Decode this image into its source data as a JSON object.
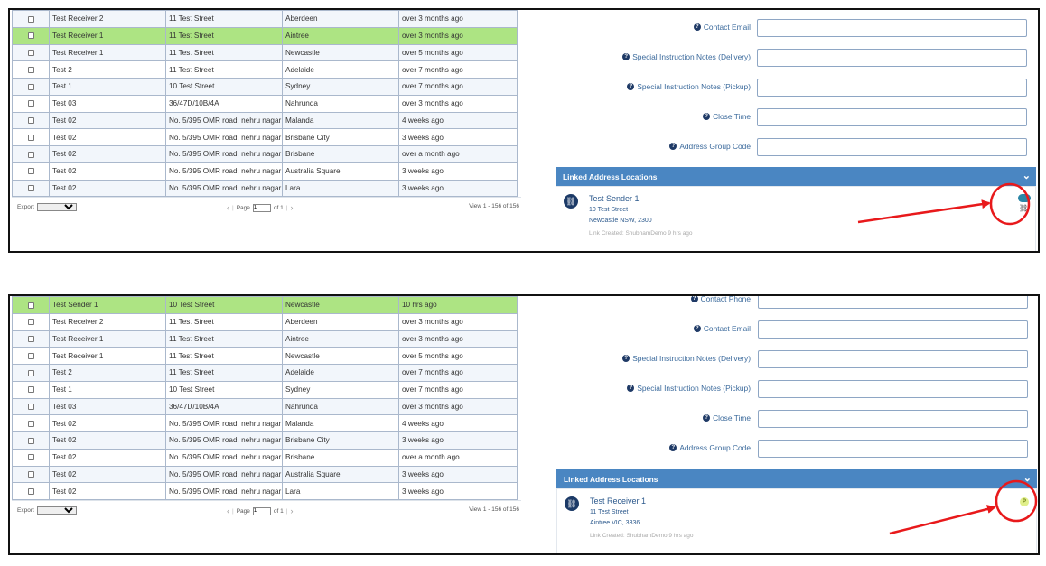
{
  "panel1": {
    "rows": [
      {
        "name": "Test Receiver 2",
        "street": "11 Test Street",
        "suburb": "Aberdeen",
        "date": "over 3 months ago",
        "highlighted": false
      },
      {
        "name": "Test Receiver 1",
        "street": "11 Test Street",
        "suburb": "Aintree",
        "date": "over 3 months ago",
        "highlighted": true
      },
      {
        "name": "Test Receiver 1",
        "street": "11 Test Street",
        "suburb": "Newcastle",
        "date": "over 5 months ago",
        "highlighted": false
      },
      {
        "name": "Test 2",
        "street": "11 Test Street",
        "suburb": "Adelaide",
        "date": "over 7 months ago",
        "highlighted": false
      },
      {
        "name": "Test 1",
        "street": "10 Test Street",
        "suburb": "Sydney",
        "date": "over 7 months ago",
        "highlighted": false
      },
      {
        "name": "Test 03",
        "street": "36/47D/10B/4A",
        "suburb": "Nahrunda",
        "date": "over 3 months ago",
        "highlighted": false
      },
      {
        "name": "Test 02",
        "street": "No. 5/395 OMR road, nehru nagar",
        "suburb": "Malanda",
        "date": "4 weeks ago",
        "highlighted": false
      },
      {
        "name": "Test 02",
        "street": "No. 5/395 OMR road, nehru nagar",
        "suburb": "Brisbane City",
        "date": "3 weeks ago",
        "highlighted": false
      },
      {
        "name": "Test 02",
        "street": "No. 5/395 OMR road, nehru nagar",
        "suburb": "Brisbane",
        "date": "over a month ago",
        "highlighted": false
      },
      {
        "name": "Test 02",
        "street": "No. 5/395 OMR road, nehru nagar",
        "suburb": "Australia Square",
        "date": "3 weeks ago",
        "highlighted": false
      },
      {
        "name": "Test 02",
        "street": "No. 5/395 OMR road, nehru nagar",
        "suburb": "Lara",
        "date": "3 weeks ago",
        "highlighted": false
      }
    ],
    "pager": {
      "export_label": "Export",
      "page_label": "Page",
      "page_value": "1",
      "of_label": "of 1",
      "view_label": "View 1 - 156 of 156"
    },
    "form": [
      {
        "label": "Contact Email"
      },
      {
        "label": "Special Instruction Notes (Delivery)"
      },
      {
        "label": "Special Instruction Notes (Pickup)"
      },
      {
        "label": "Close Time"
      },
      {
        "label": "Address Group Code"
      }
    ],
    "linked": {
      "header": "Linked Address Locations",
      "name": "Test Sender 1",
      "street": "10 Test Street",
      "city": "Newcastle NSW, 2300",
      "created": "Link Created: ShubhamDemo 9 hrs ago"
    }
  },
  "panel2": {
    "rows": [
      {
        "name": "Test Sender 1",
        "street": "10 Test Street",
        "suburb": "Newcastle",
        "date": "10 hrs ago",
        "highlighted": true
      },
      {
        "name": "Test Receiver 2",
        "street": "11 Test Street",
        "suburb": "Aberdeen",
        "date": "over 3 months ago",
        "highlighted": false
      },
      {
        "name": "Test Receiver 1",
        "street": "11 Test Street",
        "suburb": "Aintree",
        "date": "over 3 months ago",
        "highlighted": false
      },
      {
        "name": "Test Receiver 1",
        "street": "11 Test Street",
        "suburb": "Newcastle",
        "date": "over 5 months ago",
        "highlighted": false
      },
      {
        "name": "Test 2",
        "street": "11 Test Street",
        "suburb": "Adelaide",
        "date": "over 7 months ago",
        "highlighted": false
      },
      {
        "name": "Test 1",
        "street": "10 Test Street",
        "suburb": "Sydney",
        "date": "over 7 months ago",
        "highlighted": false
      },
      {
        "name": "Test 03",
        "street": "36/47D/10B/4A",
        "suburb": "Nahrunda",
        "date": "over 3 months ago",
        "highlighted": false
      },
      {
        "name": "Test 02",
        "street": "No. 5/395 OMR road, nehru nagar",
        "suburb": "Malanda",
        "date": "4 weeks ago",
        "highlighted": false
      },
      {
        "name": "Test 02",
        "street": "No. 5/395 OMR road, nehru nagar",
        "suburb": "Brisbane City",
        "date": "3 weeks ago",
        "highlighted": false
      },
      {
        "name": "Test 02",
        "street": "No. 5/395 OMR road, nehru nagar",
        "suburb": "Brisbane",
        "date": "over a month ago",
        "highlighted": false
      },
      {
        "name": "Test 02",
        "street": "No. 5/395 OMR road, nehru nagar",
        "suburb": "Australia Square",
        "date": "3 weeks ago",
        "highlighted": false
      },
      {
        "name": "Test 02",
        "street": "No. 5/395 OMR road, nehru nagar",
        "suburb": "Lara",
        "date": "3 weeks ago",
        "highlighted": false
      }
    ],
    "pager": {
      "export_label": "Export",
      "page_label": "Page",
      "page_value": "1",
      "of_label": "of 1",
      "view_label": "View 1 - 156 of 156"
    },
    "form": [
      {
        "label": "Contact Phone"
      },
      {
        "label": "Contact Email"
      },
      {
        "label": "Special Instruction Notes (Delivery)"
      },
      {
        "label": "Special Instruction Notes (Pickup)"
      },
      {
        "label": "Close Time"
      },
      {
        "label": "Address Group Code"
      }
    ],
    "linked": {
      "header": "Linked Address Locations",
      "name": "Test Receiver 1",
      "street": "11 Test Street",
      "city": "Aintree VIC, 3336",
      "created": "Link Created: ShubhamDemo 9 hrs ago",
      "badge": "P"
    }
  },
  "colors": {
    "highlight_row": "#ade483",
    "header_blue": "#4a86c2",
    "annotation_red": "#e8191b"
  },
  "icons": {
    "help": "question-circle-icon",
    "link": "link-icon",
    "collapse": "chevron-down-icon",
    "unlink": "unlink-icon"
  }
}
